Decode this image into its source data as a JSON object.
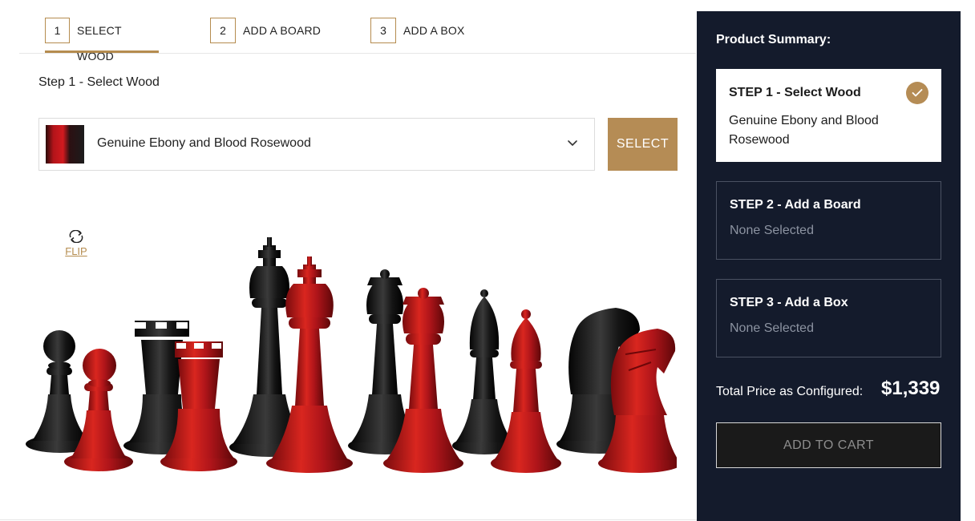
{
  "tabs": [
    {
      "number": "1",
      "label": "SELECT WOOD",
      "active": true
    },
    {
      "number": "2",
      "label": "ADD A BOARD",
      "active": false
    },
    {
      "number": "3",
      "label": "ADD A BOX",
      "active": false
    }
  ],
  "step_heading": "Step 1 - Select Wood",
  "wood_select": {
    "value": "Genuine Ebony and Blood Rosewood",
    "icon": "chevron-down-icon",
    "button_label": "SELECT"
  },
  "flip": {
    "label": "FLIP",
    "icon": "flip-icon"
  },
  "chess_pieces": {
    "colors": {
      "ebony": "#141414",
      "rosewood": "#c8191d"
    },
    "order": [
      "pawn",
      "rook",
      "king",
      "queen",
      "bishop",
      "knight"
    ]
  },
  "summary": {
    "title": "Product Summary:",
    "steps": [
      {
        "title": "STEP 1 - Select Wood",
        "value": "Genuine Ebony and Blood Rosewood",
        "completed": true
      },
      {
        "title": "STEP 2 - Add a Board",
        "value": "None Selected",
        "completed": false
      },
      {
        "title": "STEP 3 - Add a Box",
        "value": "None Selected",
        "completed": false
      }
    ],
    "total_label": "Total Price as Configured:",
    "total_price": "$1,339",
    "cart_label": "ADD TO CART"
  },
  "colors": {
    "accent": "#b58c55",
    "panel_bg": "#141b2c",
    "muted_text": "#8c93a1"
  }
}
